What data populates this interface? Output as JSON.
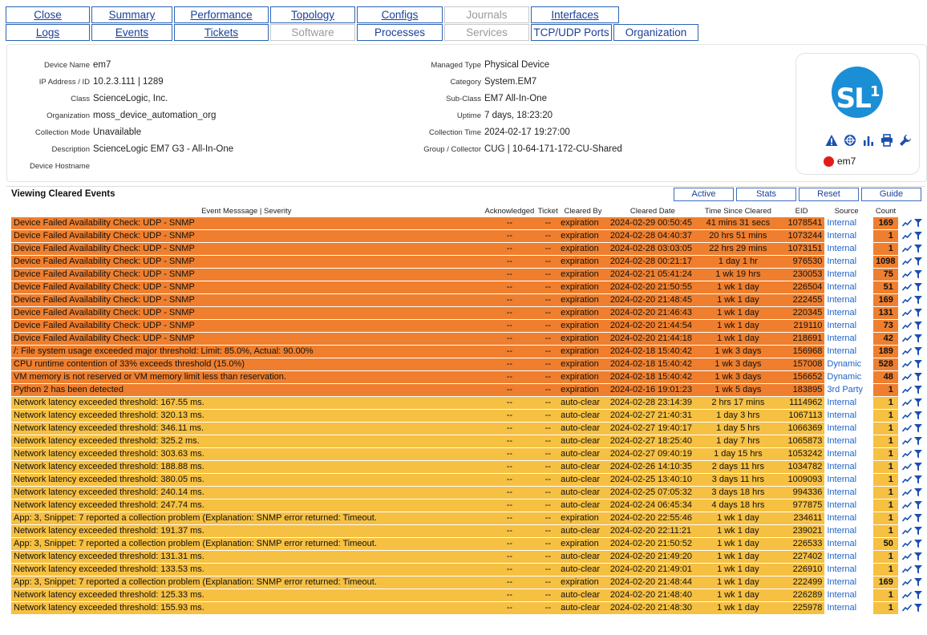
{
  "tabs_row1": [
    {
      "label": "Close",
      "state": "link"
    },
    {
      "label": "Summary",
      "state": "link"
    },
    {
      "label": "Performance",
      "state": "link"
    },
    {
      "label": "Topology",
      "state": "link"
    },
    {
      "label": "Configs",
      "state": "link"
    },
    {
      "label": "Journals",
      "state": "disabled"
    },
    {
      "label": "Interfaces",
      "state": "link"
    }
  ],
  "tabs_row2": [
    {
      "label": "Logs",
      "state": "link"
    },
    {
      "label": "Events",
      "state": "link"
    },
    {
      "label": "Tickets",
      "state": "link"
    },
    {
      "label": "Software",
      "state": "disabled"
    },
    {
      "label": "Processes",
      "state": "plain"
    },
    {
      "label": "Services",
      "state": "disabled"
    },
    {
      "label": "TCP/UDP Ports",
      "state": "plain"
    },
    {
      "label": "Organization",
      "state": "plain"
    }
  ],
  "device": {
    "left": [
      {
        "key": "Device Name",
        "value": "em7"
      },
      {
        "key": "IP Address / ID",
        "value": "10.2.3.111 | 1289"
      },
      {
        "key": "Class",
        "value": "ScienceLogic, Inc."
      },
      {
        "key": "Organization",
        "value": "moss_device_automation_org"
      },
      {
        "key": "Collection Mode",
        "value": "Unavailable"
      },
      {
        "key": "Description",
        "value": "ScienceLogic EM7 G3 - All-In-One"
      },
      {
        "key": "Device Hostname",
        "value": ""
      }
    ],
    "right": [
      {
        "key": "Managed Type",
        "value": "Physical Device"
      },
      {
        "key": "Category",
        "value": "System.EM7"
      },
      {
        "key": "Sub-Class",
        "value": "EM7 All-In-One"
      },
      {
        "key": "Uptime",
        "value": "7 days, 18:23:20"
      },
      {
        "key": "Collection Time",
        "value": "2024-02-17 19:27:00"
      },
      {
        "key": "Group / Collector",
        "value": "CUG | 10-64-171-172-CU-Shared"
      }
    ],
    "logo_text": "SL",
    "logo_sup": "1",
    "status_name": "em7",
    "status_color": "#e31b1b",
    "action_icons": [
      "warning-icon",
      "globe-icon",
      "bar-chart-icon",
      "printer-icon",
      "wrench-icon"
    ]
  },
  "events": {
    "title": "Viewing Cleared Events",
    "buttons": [
      "Active",
      "Stats",
      "Reset",
      "Guide"
    ],
    "columns": [
      "Event Messsage | Severity",
      "Acknowledged",
      "Ticket",
      "Cleared By",
      "Cleared Date",
      "Time Since Cleared",
      "EID",
      "Source",
      "Count"
    ],
    "severity_colors": {
      "major": "#ef7f2e",
      "minor": "#f6c042"
    },
    "rows": [
      {
        "msg": "Device Failed Availability Check: UDP - SNMP",
        "sev": "major",
        "ack": "--",
        "ticket": "--",
        "by": "expiration",
        "date": "2024-02-29 00:50:45",
        "since": "41 mins 31 secs",
        "eid": "1078541",
        "source": "Internal",
        "count": "169"
      },
      {
        "msg": "Device Failed Availability Check: UDP - SNMP",
        "sev": "major",
        "ack": "--",
        "ticket": "--",
        "by": "expiration",
        "date": "2024-02-28 04:40:37",
        "since": "20 hrs 51 mins",
        "eid": "1073244",
        "source": "Internal",
        "count": "1"
      },
      {
        "msg": "Device Failed Availability Check: UDP - SNMP",
        "sev": "major",
        "ack": "--",
        "ticket": "--",
        "by": "expiration",
        "date": "2024-02-28 03:03:05",
        "since": "22 hrs 29 mins",
        "eid": "1073151",
        "source": "Internal",
        "count": "1"
      },
      {
        "msg": "Device Failed Availability Check: UDP - SNMP",
        "sev": "major",
        "ack": "--",
        "ticket": "--",
        "by": "expiration",
        "date": "2024-02-28 00:21:17",
        "since": "1 day 1 hr",
        "eid": "976530",
        "source": "Internal",
        "count": "1098"
      },
      {
        "msg": "Device Failed Availability Check: UDP - SNMP",
        "sev": "major",
        "ack": "--",
        "ticket": "--",
        "by": "expiration",
        "date": "2024-02-21 05:41:24",
        "since": "1 wk 19 hrs",
        "eid": "230053",
        "source": "Internal",
        "count": "75"
      },
      {
        "msg": "Device Failed Availability Check: UDP - SNMP",
        "sev": "major",
        "ack": "--",
        "ticket": "--",
        "by": "expiration",
        "date": "2024-02-20 21:50:55",
        "since": "1 wk 1 day",
        "eid": "226504",
        "source": "Internal",
        "count": "51"
      },
      {
        "msg": "Device Failed Availability Check: UDP - SNMP",
        "sev": "major",
        "ack": "--",
        "ticket": "--",
        "by": "expiration",
        "date": "2024-02-20 21:48:45",
        "since": "1 wk 1 day",
        "eid": "222455",
        "source": "Internal",
        "count": "169"
      },
      {
        "msg": "Device Failed Availability Check: UDP - SNMP",
        "sev": "major",
        "ack": "--",
        "ticket": "--",
        "by": "expiration",
        "date": "2024-02-20 21:46:43",
        "since": "1 wk 1 day",
        "eid": "220345",
        "source": "Internal",
        "count": "131"
      },
      {
        "msg": "Device Failed Availability Check: UDP - SNMP",
        "sev": "major",
        "ack": "--",
        "ticket": "--",
        "by": "expiration",
        "date": "2024-02-20 21:44:54",
        "since": "1 wk 1 day",
        "eid": "219110",
        "source": "Internal",
        "count": "73"
      },
      {
        "msg": "Device Failed Availability Check: UDP - SNMP",
        "sev": "major",
        "ack": "--",
        "ticket": "--",
        "by": "expiration",
        "date": "2024-02-20 21:44:18",
        "since": "1 wk 1 day",
        "eid": "218691",
        "source": "Internal",
        "count": "42"
      },
      {
        "msg": "/: File system usage exceeded major threshold: Limit: 85.0%, Actual: 90.00%",
        "sev": "major",
        "ack": "--",
        "ticket": "--",
        "by": "expiration",
        "date": "2024-02-18 15:40:42",
        "since": "1 wk 3 days",
        "eid": "156968",
        "source": "Internal",
        "count": "189"
      },
      {
        "msg": "CPU runtime contention of 33% exceeds threshold (15.0%)",
        "sev": "major",
        "ack": "--",
        "ticket": "--",
        "by": "expiration",
        "date": "2024-02-18 15:40:42",
        "since": "1 wk 3 days",
        "eid": "157008",
        "source": "Dynamic",
        "count": "528"
      },
      {
        "msg": "VM memory is not reserved or VM memory limit less than reservation.",
        "sev": "major",
        "ack": "--",
        "ticket": "--",
        "by": "expiration",
        "date": "2024-02-18 15:40:42",
        "since": "1 wk 3 days",
        "eid": "156652",
        "source": "Dynamic",
        "count": "48"
      },
      {
        "msg": "Python 2 has been detected",
        "sev": "major",
        "ack": "--",
        "ticket": "--",
        "by": "expiration",
        "date": "2024-02-16 19:01:23",
        "since": "1 wk 5 days",
        "eid": "183895",
        "source": "3rd Party",
        "count": "1"
      },
      {
        "msg": "Network latency exceeded threshold: 167.55 ms.",
        "sev": "minor",
        "ack": "--",
        "ticket": "--",
        "by": "auto-clear",
        "date": "2024-02-28 23:14:39",
        "since": "2 hrs 17 mins",
        "eid": "1114962",
        "source": "Internal",
        "count": "1"
      },
      {
        "msg": "Network latency exceeded threshold: 320.13 ms.",
        "sev": "minor",
        "ack": "--",
        "ticket": "--",
        "by": "auto-clear",
        "date": "2024-02-27 21:40:31",
        "since": "1 day 3 hrs",
        "eid": "1067113",
        "source": "Internal",
        "count": "1"
      },
      {
        "msg": "Network latency exceeded threshold: 346.11 ms.",
        "sev": "minor",
        "ack": "--",
        "ticket": "--",
        "by": "auto-clear",
        "date": "2024-02-27 19:40:17",
        "since": "1 day 5 hrs",
        "eid": "1066369",
        "source": "Internal",
        "count": "1"
      },
      {
        "msg": "Network latency exceeded threshold: 325.2 ms.",
        "sev": "minor",
        "ack": "--",
        "ticket": "--",
        "by": "auto-clear",
        "date": "2024-02-27 18:25:40",
        "since": "1 day 7 hrs",
        "eid": "1065873",
        "source": "Internal",
        "count": "1"
      },
      {
        "msg": "Network latency exceeded threshold: 303.63 ms.",
        "sev": "minor",
        "ack": "--",
        "ticket": "--",
        "by": "auto-clear",
        "date": "2024-02-27 09:40:19",
        "since": "1 day 15 hrs",
        "eid": "1053242",
        "source": "Internal",
        "count": "1"
      },
      {
        "msg": "Network latency exceeded threshold: 188.88 ms.",
        "sev": "minor",
        "ack": "--",
        "ticket": "--",
        "by": "auto-clear",
        "date": "2024-02-26 14:10:35",
        "since": "2 days 11 hrs",
        "eid": "1034782",
        "source": "Internal",
        "count": "1"
      },
      {
        "msg": "Network latency exceeded threshold: 380.05 ms.",
        "sev": "minor",
        "ack": "--",
        "ticket": "--",
        "by": "auto-clear",
        "date": "2024-02-25 13:40:10",
        "since": "3 days 11 hrs",
        "eid": "1009093",
        "source": "Internal",
        "count": "1"
      },
      {
        "msg": "Network latency exceeded threshold: 240.14 ms.",
        "sev": "minor",
        "ack": "--",
        "ticket": "--",
        "by": "auto-clear",
        "date": "2024-02-25 07:05:32",
        "since": "3 days 18 hrs",
        "eid": "994336",
        "source": "Internal",
        "count": "1"
      },
      {
        "msg": "Network latency exceeded threshold: 247.74 ms.",
        "sev": "minor",
        "ack": "--",
        "ticket": "--",
        "by": "auto-clear",
        "date": "2024-02-24 06:45:34",
        "since": "4 days 18 hrs",
        "eid": "977875",
        "source": "Internal",
        "count": "1"
      },
      {
        "msg": "App: 3, Snippet: 7 reported a collection problem (Explanation: SNMP error returned: Timeout.",
        "sev": "minor",
        "ack": "--",
        "ticket": "--",
        "by": "expiration",
        "date": "2024-02-20 22:55:46",
        "since": "1 wk 1 day",
        "eid": "234611",
        "source": "Internal",
        "count": "1"
      },
      {
        "msg": "Network latency exceeded threshold: 191.37 ms.",
        "sev": "minor",
        "ack": "--",
        "ticket": "--",
        "by": "auto-clear",
        "date": "2024-02-20 22:11:21",
        "since": "1 wk 1 day",
        "eid": "239021",
        "source": "Internal",
        "count": "1"
      },
      {
        "msg": "App: 3, Snippet: 7 reported a collection problem (Explanation: SNMP error returned: Timeout.",
        "sev": "minor",
        "ack": "--",
        "ticket": "--",
        "by": "expiration",
        "date": "2024-02-20 21:50:52",
        "since": "1 wk 1 day",
        "eid": "226533",
        "source": "Internal",
        "count": "50"
      },
      {
        "msg": "Network latency exceeded threshold: 131.31 ms.",
        "sev": "minor",
        "ack": "--",
        "ticket": "--",
        "by": "auto-clear",
        "date": "2024-02-20 21:49:20",
        "since": "1 wk 1 day",
        "eid": "227402",
        "source": "Internal",
        "count": "1"
      },
      {
        "msg": "Network latency exceeded threshold: 133.53 ms.",
        "sev": "minor",
        "ack": "--",
        "ticket": "--",
        "by": "auto-clear",
        "date": "2024-02-20 21:49:01",
        "since": "1 wk 1 day",
        "eid": "226910",
        "source": "Internal",
        "count": "1"
      },
      {
        "msg": "App: 3, Snippet: 7 reported a collection problem (Explanation: SNMP error returned: Timeout.",
        "sev": "minor",
        "ack": "--",
        "ticket": "--",
        "by": "expiration",
        "date": "2024-02-20 21:48:44",
        "since": "1 wk 1 day",
        "eid": "222499",
        "source": "Internal",
        "count": "169"
      },
      {
        "msg": "Network latency exceeded threshold: 125.33 ms.",
        "sev": "minor",
        "ack": "--",
        "ticket": "--",
        "by": "auto-clear",
        "date": "2024-02-20 21:48:40",
        "since": "1 wk 1 day",
        "eid": "226289",
        "source": "Internal",
        "count": "1"
      },
      {
        "msg": "Network latency exceeded threshold: 155.93 ms.",
        "sev": "minor",
        "ack": "--",
        "ticket": "--",
        "by": "auto-clear",
        "date": "2024-02-20 21:48:30",
        "since": "1 wk 1 day",
        "eid": "225978",
        "source": "Internal",
        "count": "1"
      }
    ]
  }
}
